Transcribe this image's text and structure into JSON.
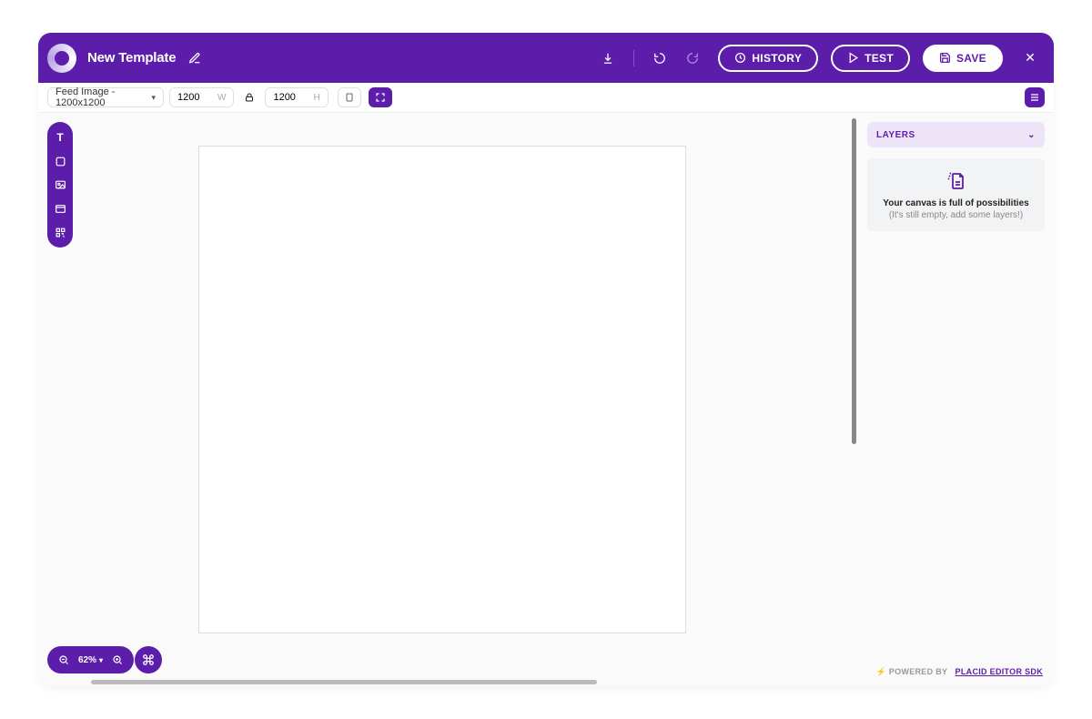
{
  "header": {
    "title": "New Template",
    "history_label": "HISTORY",
    "test_label": "TEST",
    "save_label": "SAVE"
  },
  "toolbar": {
    "preset_label": "Feed Image - 1200x1200",
    "width_value": "1200",
    "width_unit": "W",
    "height_value": "1200",
    "height_unit": "H"
  },
  "left_tools": {
    "text_label": "T"
  },
  "zoom": {
    "value": "62%"
  },
  "right": {
    "layers_label": "LAYERS",
    "empty_title": "Your canvas is full of possibilities",
    "empty_sub": "(It's still empty, add some layers!)"
  },
  "footer": {
    "powered_by": "POWERED BY",
    "link_label": "PLACID EDITOR SDK"
  }
}
